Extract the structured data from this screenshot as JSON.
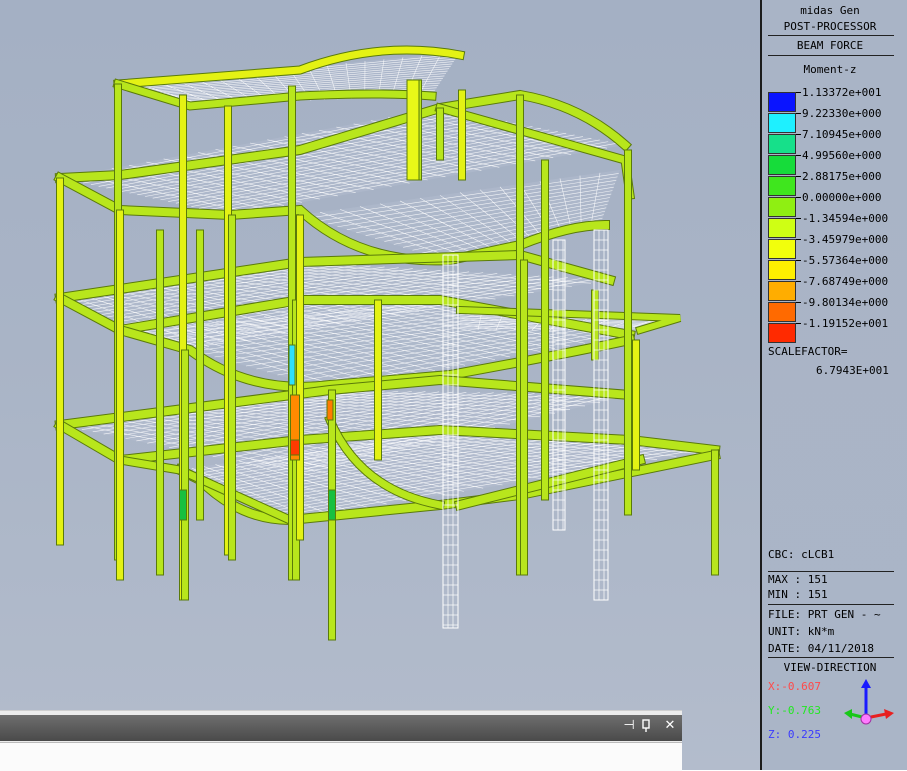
{
  "app": {
    "name": "midas Gen",
    "mode": "POST-PROCESSOR"
  },
  "result": {
    "type": "BEAM FORCE",
    "component": "Moment-z"
  },
  "legend": [
    {
      "value": "1.13372e+001",
      "color": "#0a14ff"
    },
    {
      "value": "9.22330e+000",
      "color": "#1ef0ff"
    },
    {
      "value": "7.10945e+000",
      "color": "#16e08a"
    },
    {
      "value": "4.99560e+000",
      "color": "#16dc3a"
    },
    {
      "value": "2.88175e+000",
      "color": "#3fe61e"
    },
    {
      "value": "0.00000e+000",
      "color": "#8fef12"
    },
    {
      "value": "-1.34594e+000",
      "color": "#cfff14"
    },
    {
      "value": "-3.45979e+000",
      "color": "#f2ff0c"
    },
    {
      "value": "-5.57364e+000",
      "color": "#fff000"
    },
    {
      "value": "-7.68749e+000",
      "color": "#ffad00"
    },
    {
      "value": "-9.80134e+000",
      "color": "#ff6a00"
    },
    {
      "value": "-1.19152e+001",
      "color": "#ff2a00"
    }
  ],
  "scalefactor": {
    "label": "SCALEFACTOR=",
    "value": "6.7943E+001"
  },
  "info": {
    "cbc": "CBC: cLCB1",
    "max": "MAX : 151",
    "min": "MIN : 151",
    "file": "FILE: PRT GEN - ~",
    "unit": "UNIT: kN*m",
    "date": "DATE: 04/11/2018"
  },
  "view_direction": {
    "title": "VIEW-DIRECTION",
    "x": "X:-0.607",
    "y": "Y:-0.763",
    "z": "Z: 0.225",
    "x_color": "#ff4a4a",
    "y_color": "#22e822",
    "z_color": "#3a3aff"
  },
  "dock": {
    "pin_glyph": "⊣",
    "close_glyph": "✕"
  }
}
